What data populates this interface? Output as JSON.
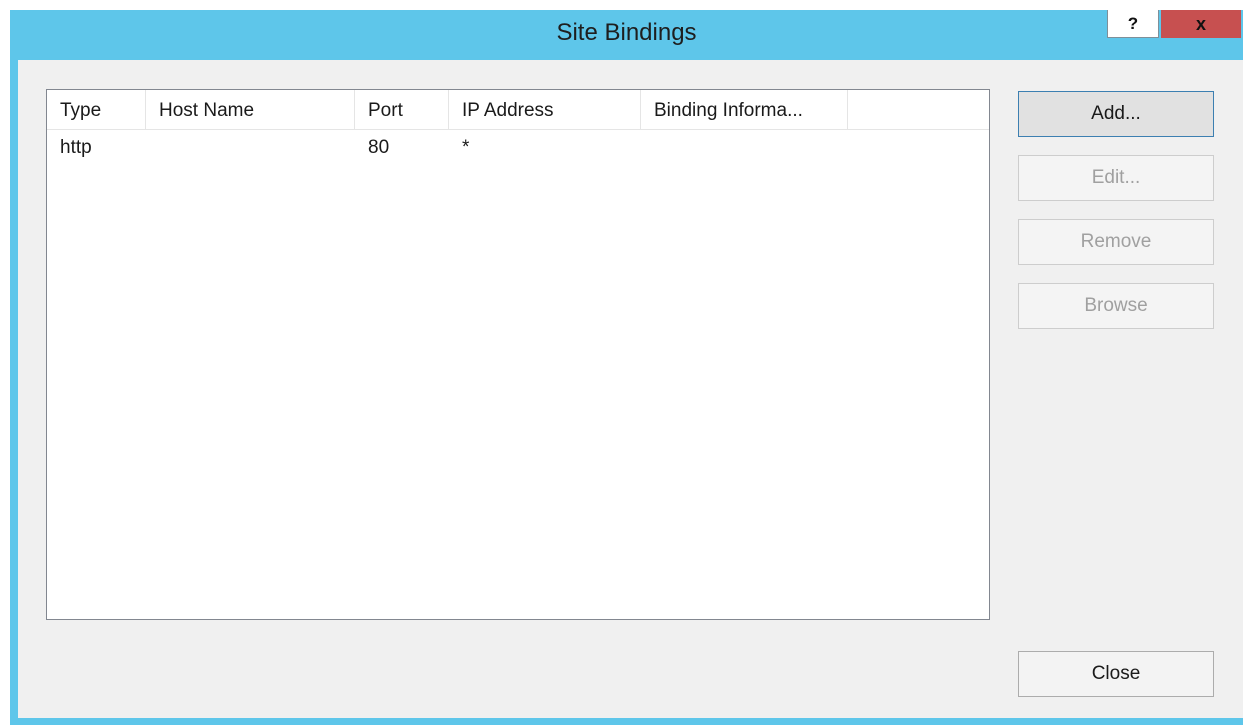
{
  "window": {
    "title": "Site Bindings",
    "help_label": "?",
    "close_label": "x"
  },
  "bindings_list": {
    "columns": [
      "Type",
      "Host Name",
      "Port",
      "IP Address",
      "Binding Informa..."
    ],
    "rows": [
      {
        "type": "http",
        "host_name": "",
        "port": "80",
        "ip_address": "*",
        "binding_info": ""
      }
    ]
  },
  "buttons": {
    "add": "Add...",
    "edit": "Edit...",
    "remove": "Remove",
    "browse": "Browse",
    "close": "Close"
  },
  "button_states": {
    "add": "enabled",
    "edit": "disabled",
    "remove": "disabled",
    "browse": "disabled",
    "close": "enabled"
  },
  "colors": {
    "titlebar": "#5ec6ea",
    "close_button": "#c75050",
    "dialog_background": "#f0f0f0"
  }
}
